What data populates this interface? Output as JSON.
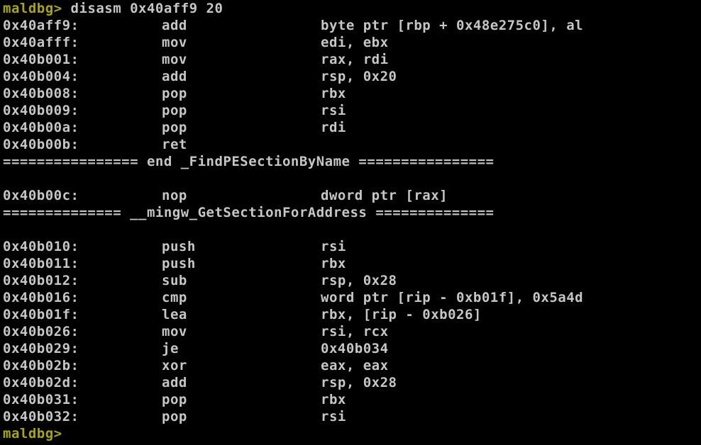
{
  "colors": {
    "background": "#000000",
    "text": "#c6c6c6",
    "prompt": "#a8a800"
  },
  "command": {
    "prompt": "maldbg>",
    "text": " disasm 0x40aff9 20"
  },
  "block1": [
    {
      "addr": "0x40aff9:",
      "mnem": "add",
      "ops": "byte ptr [rbp + 0x48e275c0], al"
    },
    {
      "addr": "0x40afff:",
      "mnem": "mov",
      "ops": "edi, ebx"
    },
    {
      "addr": "0x40b001:",
      "mnem": "mov",
      "ops": "rax, rdi"
    },
    {
      "addr": "0x40b004:",
      "mnem": "add",
      "ops": "rsp, 0x20"
    },
    {
      "addr": "0x40b008:",
      "mnem": "pop",
      "ops": "rbx"
    },
    {
      "addr": "0x40b009:",
      "mnem": "pop",
      "ops": "rsi"
    },
    {
      "addr": "0x40b00a:",
      "mnem": "pop",
      "ops": "rdi"
    },
    {
      "addr": "0x40b00b:",
      "mnem": "ret",
      "ops": ""
    }
  ],
  "separator1": "================ end _FindPESectionByName ================",
  "block2": [
    {
      "addr": "0x40b00c:",
      "mnem": "nop",
      "ops": "dword ptr [rax]"
    }
  ],
  "separator2": "============== __mingw_GetSectionForAddress ==============",
  "block3": [
    {
      "addr": "0x40b010:",
      "mnem": "push",
      "ops": "rsi"
    },
    {
      "addr": "0x40b011:",
      "mnem": "push",
      "ops": "rbx"
    },
    {
      "addr": "0x40b012:",
      "mnem": "sub",
      "ops": "rsp, 0x28"
    },
    {
      "addr": "0x40b016:",
      "mnem": "cmp",
      "ops": "word ptr [rip - 0xb01f], 0x5a4d"
    },
    {
      "addr": "0x40b01f:",
      "mnem": "lea",
      "ops": "rbx, [rip - 0xb026]"
    },
    {
      "addr": "0x40b026:",
      "mnem": "mov",
      "ops": "rsi, rcx"
    },
    {
      "addr": "0x40b029:",
      "mnem": "je",
      "ops": "0x40b034"
    },
    {
      "addr": "0x40b02b:",
      "mnem": "xor",
      "ops": "eax, eax"
    },
    {
      "addr": "0x40b02d:",
      "mnem": "add",
      "ops": "rsp, 0x28"
    },
    {
      "addr": "0x40b031:",
      "mnem": "pop",
      "ops": "rbx"
    },
    {
      "addr": "0x40b032:",
      "mnem": "pop",
      "ops": "rsi"
    }
  ],
  "final_prompt": "maldbg>"
}
